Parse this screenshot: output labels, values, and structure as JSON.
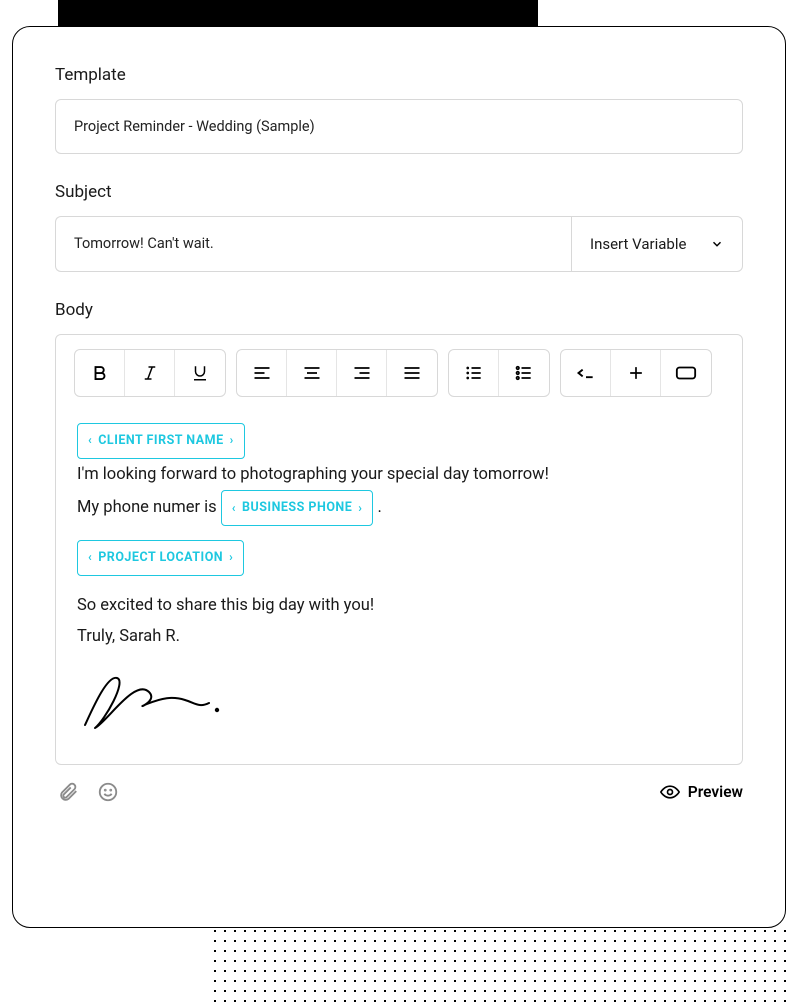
{
  "labels": {
    "template": "Template",
    "subject": "Subject",
    "body": "Body"
  },
  "template": {
    "value": "Project Reminder - Wedding (Sample)"
  },
  "subject": {
    "value": "Tomorrow! Can't wait.",
    "insert_variable": "Insert Variable"
  },
  "body": {
    "vars": {
      "client_first_name": "CLIENT FIRST NAME",
      "business_phone": "BUSINESS PHONE",
      "project_location": "PROJECT LOCATION"
    },
    "text": {
      "line1": "I'm looking forward to photographing your special day tomorrow!",
      "line2_pre": "My phone numer is ",
      "line2_post": " .",
      "line3": "So excited to share this big day with you!",
      "line4": "Truly, Sarah R."
    }
  },
  "footer": {
    "preview": "Preview"
  }
}
